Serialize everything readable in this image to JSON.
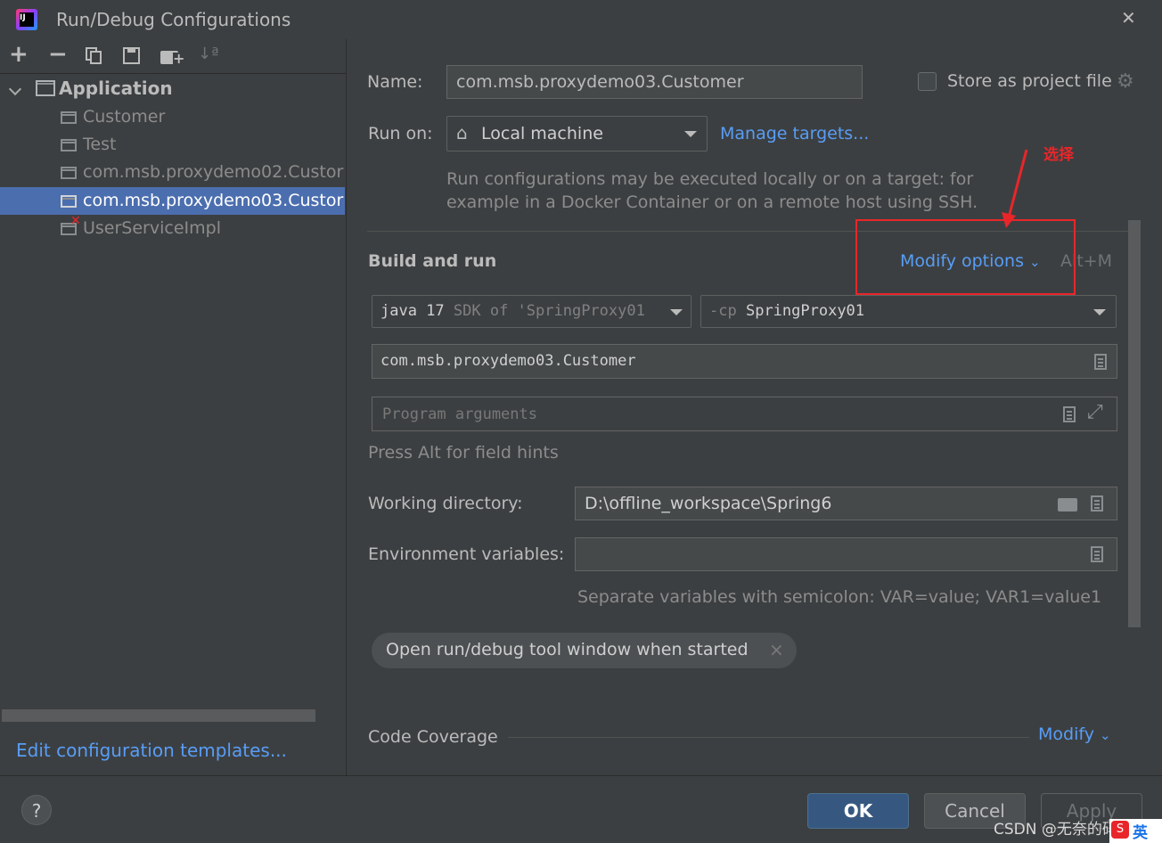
{
  "window": {
    "title": "Run/Debug Configurations",
    "close_glyph": "✕",
    "app_icon_text": "IJ"
  },
  "toolbar": {
    "add": "+",
    "remove": "−",
    "sort": "↓ª"
  },
  "tree": {
    "group_label": "Application",
    "items": [
      {
        "label": "Customer",
        "status": "normal"
      },
      {
        "label": "Test",
        "status": "normal"
      },
      {
        "label": "com.msb.proxydemo02.Custor",
        "status": "normal"
      },
      {
        "label": "com.msb.proxydemo03.Custor",
        "status": "selected"
      },
      {
        "label": "UserServiceImpl",
        "status": "error"
      }
    ]
  },
  "edit_templates_link": "Edit configuration templates...",
  "form": {
    "name_label": "Name:",
    "name_value": "com.msb.proxydemo03.Customer",
    "store_label": "Store as project file",
    "store_checked": false,
    "run_on_label": "Run on:",
    "run_on_value": "Local machine",
    "manage_targets": "Manage targets...",
    "run_on_hint_1": "Run configurations may be executed locally or on a target: for",
    "run_on_hint_2": "example in a Docker Container or on a remote host using SSH.",
    "section_build_run": "Build and run",
    "modify_options": "Modify options",
    "modify_shortcut": "Alt+M",
    "sdk_java": "java 17",
    "sdk_rest": "SDK of 'SpringProxy01",
    "cp_prefix": "-cp",
    "cp_value": "SpringProxy01",
    "main_class": "com.msb.proxydemo03.Customer",
    "program_args_placeholder": "Program arguments",
    "field_hint": "Press Alt for field hints",
    "working_dir_label": "Working directory:",
    "working_dir_value": "D:\\offline_workspace\\Spring6",
    "env_label": "Environment variables:",
    "env_value": "",
    "env_hint": "Separate variables with semicolon: VAR=value; VAR1=value1",
    "chip_label": "Open run/debug tool window when started",
    "chip_close": "×",
    "coverage_label": "Code Coverage",
    "coverage_modify": "Modify"
  },
  "annotation": {
    "text": "选择",
    "color": "#e8262a"
  },
  "footer": {
    "help": "?",
    "ok": "OK",
    "cancel": "Cancel",
    "apply": "Apply",
    "watermark": "CSDN @无奈的码农",
    "ime_label": "英"
  },
  "colors": {
    "accent": "#589df6",
    "selection": "#4b6eaf",
    "ok_button": "#365880"
  }
}
